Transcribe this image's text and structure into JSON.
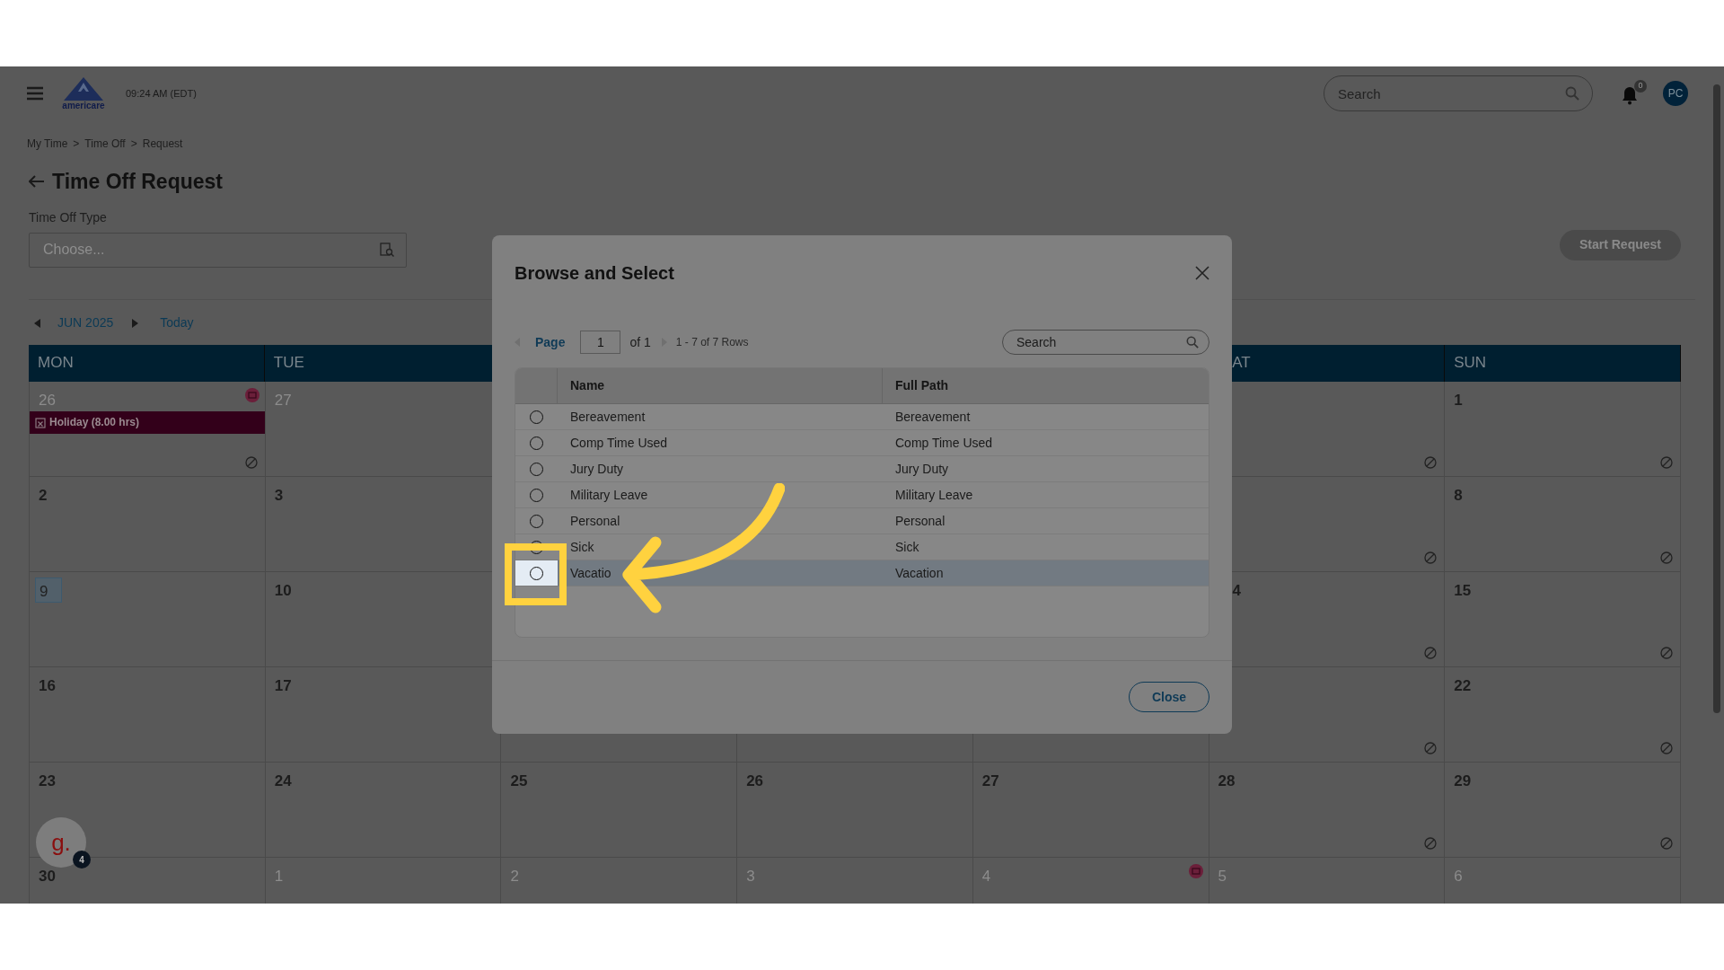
{
  "top_bar": {
    "time": "09:24 AM (EDT)",
    "logo_text": "americare",
    "search": {
      "placeholder": "Search"
    },
    "notifications": "0",
    "avatar": "PC"
  },
  "breadcrumb": {
    "items": [
      "My Time",
      "Time Off",
      "Request"
    ],
    "separator": ">"
  },
  "page_title": "Time Off Request",
  "time_off_type": {
    "label": "Time Off Type",
    "placeholder": "Choose..."
  },
  "start_request": {
    "label": "Start Request",
    "disabled": true
  },
  "calendar": {
    "month": "JUN 2025",
    "today_label": "Today",
    "columns": [
      {
        "kind": "mon",
        "label": "MON",
        "cut": false
      },
      {
        "kind": "tue",
        "label": "TUE",
        "cut": false
      },
      {
        "kind": "sat",
        "label": "AT",
        "cut": true
      },
      {
        "kind": "sun",
        "label": "SUN",
        "cut": false
      }
    ],
    "weeks": [
      [
        {
          "kind": "mon",
          "day": "26",
          "muted": true,
          "holiday": true,
          "event": "Holiday (8.00 hrs)",
          "blocked": true
        },
        {
          "kind": "tue",
          "day": "27",
          "muted": true
        },
        {
          "kind": "sat",
          "blocked": true
        },
        {
          "kind": "sun",
          "day": "1",
          "blocked": true
        }
      ],
      [
        {
          "kind": "mon",
          "day": "2"
        },
        {
          "kind": "tue",
          "day": "3"
        },
        {
          "kind": "sat",
          "blocked": true
        },
        {
          "kind": "sun",
          "day": "8",
          "blocked": true
        }
      ],
      [
        {
          "kind": "mon",
          "day": "9",
          "today": true
        },
        {
          "kind": "tue",
          "day": "10"
        },
        {
          "kind": "sat",
          "day": "4",
          "cut": true,
          "blocked": true
        },
        {
          "kind": "sun",
          "day": "15",
          "blocked": true
        }
      ],
      [
        {
          "kind": "mon",
          "day": "16"
        },
        {
          "kind": "tue",
          "day": "17"
        },
        {
          "kind": "sat",
          "blocked": true
        },
        {
          "kind": "sun",
          "day": "22",
          "blocked": true
        }
      ],
      [
        {
          "kind": "mon",
          "day": "23"
        },
        {
          "kind": "tue",
          "day": "24"
        },
        {
          "kind": "wed",
          "day": "25"
        },
        {
          "kind": "thu",
          "day": "26"
        },
        {
          "kind": "fri",
          "day": "27"
        },
        {
          "kind": "sat",
          "day": "28",
          "blocked": true
        },
        {
          "kind": "sun",
          "day": "29",
          "blocked": true
        }
      ],
      [
        {
          "kind": "mon",
          "day": "30"
        },
        {
          "kind": "tue",
          "day": "1",
          "muted": true
        },
        {
          "kind": "wed",
          "day": "2",
          "muted": true
        },
        {
          "kind": "thu",
          "day": "3",
          "muted": true
        },
        {
          "kind": "fri",
          "day": "4",
          "muted": true,
          "holiday": true
        },
        {
          "kind": "sat",
          "day": "5",
          "muted": true
        },
        {
          "kind": "sun",
          "day": "6",
          "muted": true
        }
      ]
    ]
  },
  "modal": {
    "title": "Browse and Select",
    "pager": {
      "label": "Page",
      "page": "1",
      "of": "of 1",
      "rows": "1 - 7 of 7 Rows"
    },
    "search": {
      "placeholder": "Search"
    },
    "columns": [
      "Name",
      "Full Path"
    ],
    "rows": [
      {
        "name": "Bereavement",
        "path": "Bereavement",
        "highlighted": false
      },
      {
        "name": "Comp Time Used",
        "path": "Comp Time Used",
        "highlighted": false
      },
      {
        "name": "Jury Duty",
        "path": "Jury Duty",
        "highlighted": false
      },
      {
        "name": "Military Leave",
        "path": "Military Leave",
        "highlighted": false
      },
      {
        "name": "Personal",
        "path": "Personal",
        "highlighted": false
      },
      {
        "name": "Sick",
        "path": "Sick",
        "highlighted": false
      },
      {
        "name": "Vacatio",
        "path": "Vacation",
        "highlighted": true
      }
    ],
    "close_label": "Close"
  },
  "guide": {
    "letter": "g.",
    "badge": "4"
  }
}
